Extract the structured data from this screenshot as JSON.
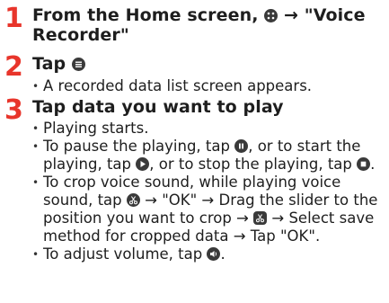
{
  "steps": [
    {
      "number": "1",
      "title_a": "From the Home screen,",
      "title_b": "→ \"Voice",
      "title_c": "Recorder\"",
      "icons": [
        "apps-icon"
      ]
    },
    {
      "number": "2",
      "title": "Tap",
      "icons": [
        "list-icon"
      ],
      "bullets": [
        "A recorded data list screen appears."
      ]
    },
    {
      "number": "3",
      "title": "Tap data you want to play",
      "bullets": [
        "Playing starts.",
        {
          "part1": "To pause the playing, tap",
          "part2": ", or to start the playing, tap",
          "part3": ", or to stop the playing, tap",
          "part4": "."
        },
        {
          "part1": "To crop voice sound, while playing voice sound, tap",
          "part2": "→ \"OK\" → Drag the slider to the position you want to crop →",
          "part3": "→ Select save method for cropped data → Tap \"OK\"."
        },
        {
          "part1": "To adjust volume, tap",
          "part2": "."
        }
      ]
    }
  ],
  "colors": {
    "step_number": "#e8352b",
    "text": "#1e1e1e",
    "icon": "#3a3a3a"
  }
}
